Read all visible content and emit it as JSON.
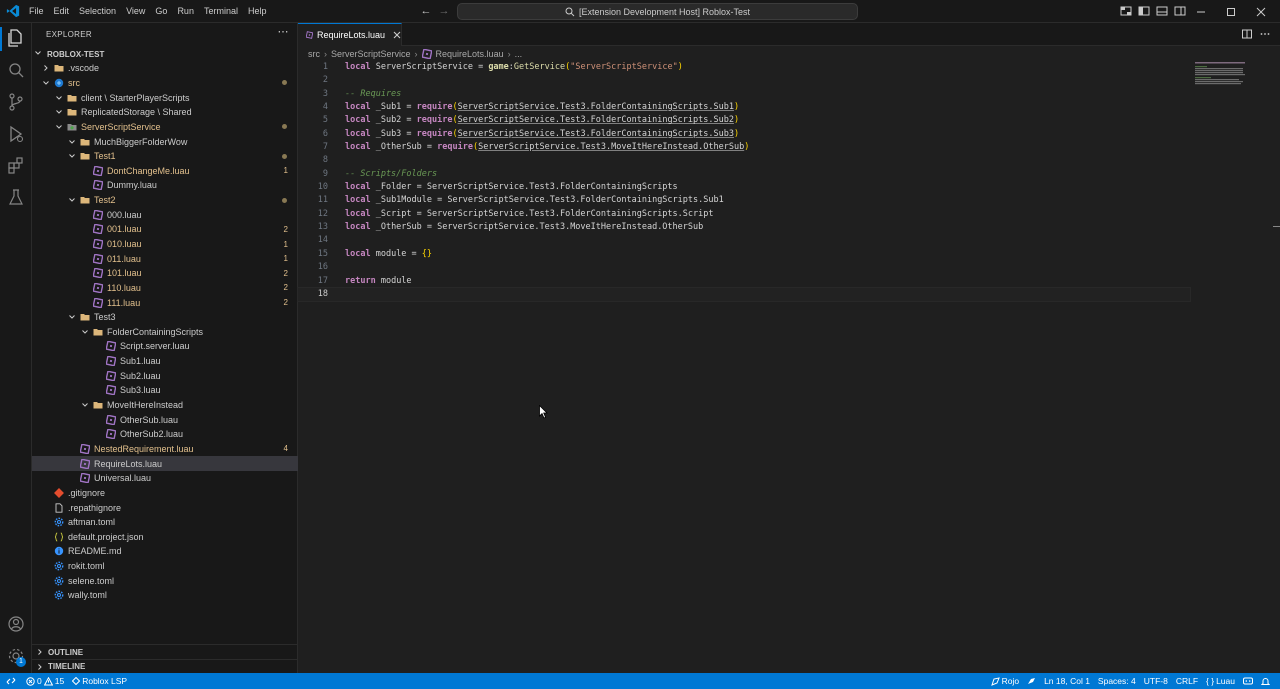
{
  "window": {
    "search_text": "[Extension Development Host] Roblox-Test",
    "menu": [
      "File",
      "Edit",
      "Selection",
      "View",
      "Go",
      "Run",
      "Terminal",
      "Help"
    ]
  },
  "colors": {
    "accent": "#0078d4",
    "modified": "#e2c08d",
    "luau_icon": "#a074c4",
    "keyword": "#c586c0",
    "string": "#ce9178",
    "comment": "#6a9955"
  },
  "sidebar": {
    "title": "EXPLORER",
    "project": "ROBLOX-TEST",
    "outline_label": "OUTLINE",
    "timeline_label": "TIMELINE",
    "tree": [
      {
        "name": ".vscode",
        "kind": "folder-collapsed",
        "depth": 0
      },
      {
        "name": "src",
        "kind": "folder-src",
        "depth": 0,
        "modified": true,
        "dot": true
      },
      {
        "name": "client \\ StarterPlayerScripts",
        "kind": "folder-open",
        "depth": 1
      },
      {
        "name": "ReplicatedStorage \\ Shared",
        "kind": "folder-open",
        "depth": 1
      },
      {
        "name": "ServerScriptService",
        "kind": "folder-service",
        "depth": 1,
        "modified": true,
        "dot": true
      },
      {
        "name": "MuchBiggerFolderWow",
        "kind": "folder-open",
        "depth": 2
      },
      {
        "name": "Test1",
        "kind": "folder-open",
        "depth": 2,
        "modified": true,
        "dot": true
      },
      {
        "name": "DontChangeMe.luau",
        "kind": "luau",
        "depth": 3,
        "modified": true,
        "badge": "1"
      },
      {
        "name": "Dummy.luau",
        "kind": "luau",
        "depth": 3
      },
      {
        "name": "Test2",
        "kind": "folder-open",
        "depth": 2,
        "modified": true,
        "dot": true
      },
      {
        "name": "000.luau",
        "kind": "luau",
        "depth": 3
      },
      {
        "name": "001.luau",
        "kind": "luau",
        "depth": 3,
        "modified": true,
        "badge": "2"
      },
      {
        "name": "010.luau",
        "kind": "luau",
        "depth": 3,
        "modified": true,
        "badge": "1"
      },
      {
        "name": "011.luau",
        "kind": "luau",
        "depth": 3,
        "modified": true,
        "badge": "1"
      },
      {
        "name": "101.luau",
        "kind": "luau",
        "depth": 3,
        "modified": true,
        "badge": "2"
      },
      {
        "name": "110.luau",
        "kind": "luau",
        "depth": 3,
        "modified": true,
        "badge": "2"
      },
      {
        "name": "111.luau",
        "kind": "luau",
        "depth": 3,
        "modified": true,
        "badge": "2"
      },
      {
        "name": "Test3",
        "kind": "folder-open",
        "depth": 2
      },
      {
        "name": "FolderContainingScripts",
        "kind": "folder-open",
        "depth": 3
      },
      {
        "name": "Script.server.luau",
        "kind": "luau",
        "depth": 4
      },
      {
        "name": "Sub1.luau",
        "kind": "luau",
        "depth": 4
      },
      {
        "name": "Sub2.luau",
        "kind": "luau",
        "depth": 4
      },
      {
        "name": "Sub3.luau",
        "kind": "luau",
        "depth": 4
      },
      {
        "name": "MoveItHereInstead",
        "kind": "folder-open",
        "depth": 3
      },
      {
        "name": "OtherSub.luau",
        "kind": "luau",
        "depth": 4
      },
      {
        "name": "OtherSub2.luau",
        "kind": "luau",
        "depth": 4
      },
      {
        "name": "NestedRequirement.luau",
        "kind": "luau",
        "depth": 2,
        "modified": true,
        "badge": "4"
      },
      {
        "name": "RequireLots.luau",
        "kind": "luau",
        "depth": 2,
        "selected": true
      },
      {
        "name": "Universal.luau",
        "kind": "luau",
        "depth": 2
      },
      {
        "name": ".gitignore",
        "kind": "git",
        "depth": 0
      },
      {
        "name": ".repathignore",
        "kind": "file",
        "depth": 0
      },
      {
        "name": "aftman.toml",
        "kind": "gear",
        "depth": 0
      },
      {
        "name": "default.project.json",
        "kind": "json",
        "depth": 0
      },
      {
        "name": "README.md",
        "kind": "info",
        "depth": 0
      },
      {
        "name": "rokit.toml",
        "kind": "gear",
        "depth": 0
      },
      {
        "name": "selene.toml",
        "kind": "gear",
        "depth": 0
      },
      {
        "name": "wally.toml",
        "kind": "gear",
        "depth": 0
      }
    ]
  },
  "editor": {
    "tab_label": "RequireLots.luau",
    "breadcrumb": [
      "src",
      "ServerScriptService",
      "RequireLots.luau",
      "..."
    ],
    "current_line": 18,
    "lines": [
      [
        [
          "kw",
          "local"
        ],
        [
          "id",
          " ServerScriptService "
        ],
        [
          "op",
          "= "
        ],
        [
          "gl",
          "game"
        ],
        [
          "op",
          ":"
        ],
        [
          "fn",
          "GetService"
        ],
        [
          "br",
          "("
        ],
        [
          "str",
          "\"ServerScriptService\""
        ],
        [
          "br",
          ")"
        ]
      ],
      [],
      [
        [
          "cm",
          "-- Requires"
        ]
      ],
      [
        [
          "kw",
          "local"
        ],
        [
          "id",
          " _Sub1 "
        ],
        [
          "op",
          "= "
        ],
        [
          "kw",
          "require"
        ],
        [
          "br",
          "("
        ],
        [
          "idu",
          "ServerScriptService.Test3.FolderContainingScripts.Sub1"
        ],
        [
          "br",
          ")"
        ]
      ],
      [
        [
          "kw",
          "local"
        ],
        [
          "id",
          " _Sub2 "
        ],
        [
          "op",
          "= "
        ],
        [
          "kw",
          "require"
        ],
        [
          "br",
          "("
        ],
        [
          "idu",
          "ServerScriptService.Test3.FolderContainingScripts.Sub2"
        ],
        [
          "br",
          ")"
        ]
      ],
      [
        [
          "kw",
          "local"
        ],
        [
          "id",
          " _Sub3 "
        ],
        [
          "op",
          "= "
        ],
        [
          "kw",
          "require"
        ],
        [
          "br",
          "("
        ],
        [
          "idu",
          "ServerScriptService.Test3.FolderContainingScripts.Sub3"
        ],
        [
          "br",
          ")"
        ]
      ],
      [
        [
          "kw",
          "local"
        ],
        [
          "id",
          " _OtherSub "
        ],
        [
          "op",
          "= "
        ],
        [
          "kw",
          "require"
        ],
        [
          "br",
          "("
        ],
        [
          "idu",
          "ServerScriptService.Test3.MoveItHereInstead.OtherSub"
        ],
        [
          "br",
          ")"
        ]
      ],
      [],
      [
        [
          "cm",
          "-- Scripts/Folders"
        ]
      ],
      [
        [
          "kw",
          "local"
        ],
        [
          "id",
          " _Folder "
        ],
        [
          "op",
          "= "
        ],
        [
          "id",
          "ServerScriptService.Test3.FolderContainingScripts"
        ]
      ],
      [
        [
          "kw",
          "local"
        ],
        [
          "id",
          " _Sub1Module "
        ],
        [
          "op",
          "= "
        ],
        [
          "id",
          "ServerScriptService.Test3.FolderContainingScripts.Sub1"
        ]
      ],
      [
        [
          "kw",
          "local"
        ],
        [
          "id",
          " _Script "
        ],
        [
          "op",
          "= "
        ],
        [
          "id",
          "ServerScriptService.Test3.FolderContainingScripts.Script"
        ]
      ],
      [
        [
          "kw",
          "local"
        ],
        [
          "id",
          " _OtherSub "
        ],
        [
          "op",
          "= "
        ],
        [
          "id",
          "ServerScriptService.Test3.MoveItHereInstead.OtherSub"
        ]
      ],
      [],
      [
        [
          "kw",
          "local"
        ],
        [
          "id",
          " module "
        ],
        [
          "op",
          "= "
        ],
        [
          "br",
          "{}"
        ]
      ],
      [],
      [
        [
          "kw",
          "return"
        ],
        [
          "id",
          " module"
        ]
      ],
      []
    ]
  },
  "statusbar": {
    "errors": "0",
    "warnings": "15",
    "lsp": "Roblox LSP",
    "theme": "Rojo",
    "position": "Ln 18, Col 1",
    "spaces": "Spaces: 4",
    "encoding": "UTF-8",
    "eol": "CRLF",
    "language": "Luau"
  },
  "activity_badge": "1"
}
